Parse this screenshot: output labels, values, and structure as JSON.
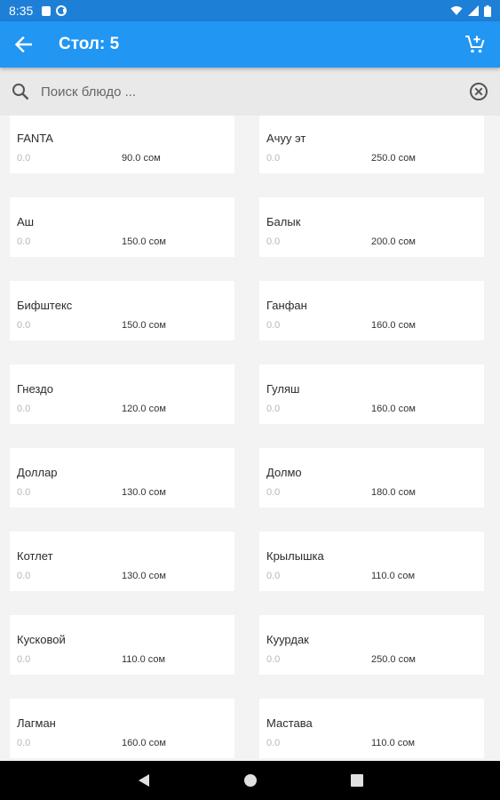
{
  "status_bar": {
    "time": "8:35"
  },
  "app_bar": {
    "title": "Стол: 5",
    "back_icon": "arrow-back-icon",
    "cart_icon": "add-shopping-cart-icon"
  },
  "search": {
    "placeholder": "Поиск блюдо ...",
    "value": ""
  },
  "menu": {
    "items": [
      {
        "name": "FANTA",
        "old": "0.0",
        "price": "90.0 сом"
      },
      {
        "name": "Ачуу эт",
        "old": "0.0",
        "price": "250.0 сом"
      },
      {
        "name": "Аш",
        "old": "0.0",
        "price": "150.0 сом"
      },
      {
        "name": "Балык",
        "old": "0.0",
        "price": "200.0 сом"
      },
      {
        "name": "Бифштекс",
        "old": "0.0",
        "price": "150.0 сом"
      },
      {
        "name": "Ганфан",
        "old": "0.0",
        "price": "160.0 сом"
      },
      {
        "name": "Гнездо",
        "old": "0.0",
        "price": "120.0 сом"
      },
      {
        "name": "Гуляш",
        "old": "0.0",
        "price": "160.0 сом"
      },
      {
        "name": "Доллар",
        "old": "0.0",
        "price": "130.0 сом"
      },
      {
        "name": "Долмо",
        "old": "0.0",
        "price": "180.0 сом"
      },
      {
        "name": "Котлет",
        "old": "0.0",
        "price": "130.0 сом"
      },
      {
        "name": "Крылышка",
        "old": "0.0",
        "price": "110.0 сом"
      },
      {
        "name": "Кусковой",
        "old": "0.0",
        "price": "110.0 сом"
      },
      {
        "name": "Куурдак",
        "old": "0.0",
        "price": "250.0 сом"
      },
      {
        "name": "Лагман",
        "old": "0.0",
        "price": "160.0 сом"
      },
      {
        "name": "Мастава",
        "old": "0.0",
        "price": "110.0 сом"
      }
    ]
  },
  "colors": {
    "primary": "#2196f3",
    "status_bar": "#1e7fd6",
    "background": "#f3f3f3",
    "card": "#ffffff",
    "nav_bar": "#000000"
  }
}
